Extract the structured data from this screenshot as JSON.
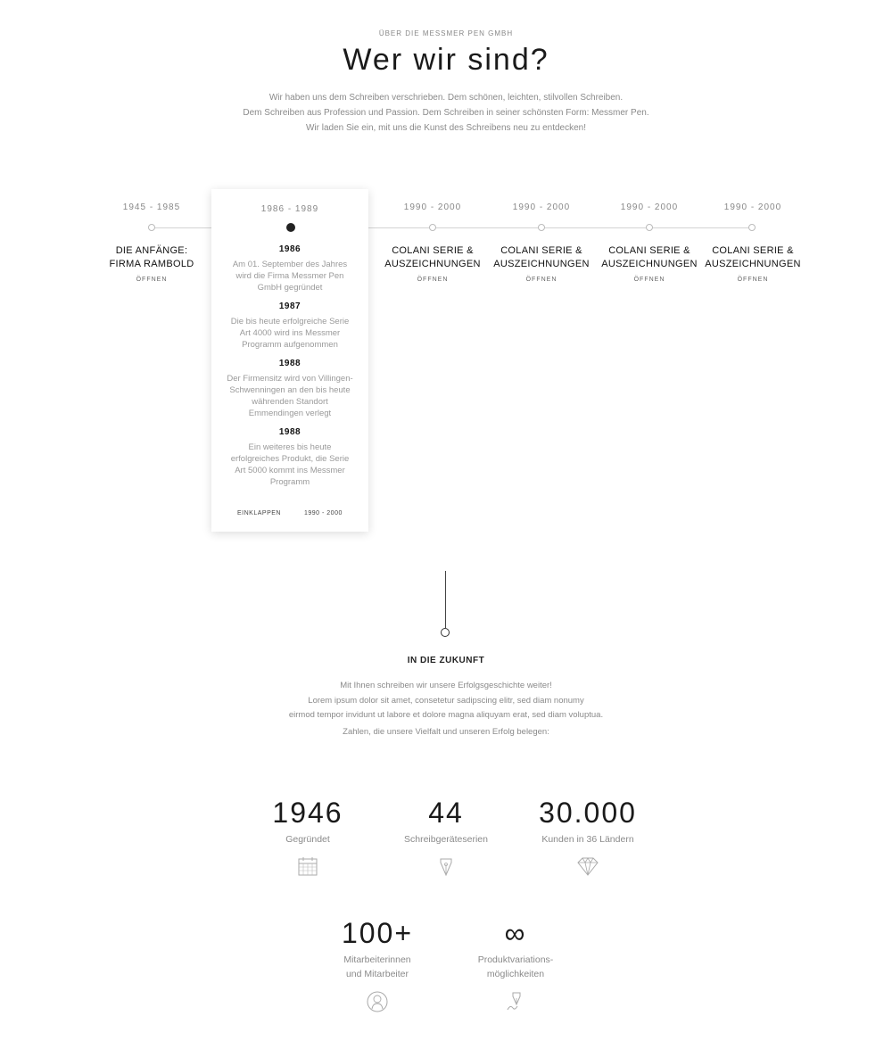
{
  "header": {
    "eyebrow": "ÜBER DIE MESSMER PEN GMBH",
    "title": "Wer wir sind?",
    "intro": [
      "Wir haben uns dem Schreiben verschrieben. Dem schönen, leichten, stilvollen Schreiben.",
      "Dem Schreiben aus Profession und Passion. Dem Schreiben in seiner schönsten Form: Messmer Pen.",
      "Wir laden Sie ein, mit uns die Kunst des Schreibens neu zu entdecken!"
    ]
  },
  "timeline": {
    "items": [
      {
        "date": "1945 - 1985",
        "title_lines": [
          "DIE ANFÄNGE:",
          "FIRMA RAMBOLD"
        ],
        "link": "ÖFFNEN"
      },
      {
        "date": "1986 - 1989",
        "expanded": true
      },
      {
        "date": "1990 - 2000",
        "title_lines": [
          "COLANI SERIE &",
          "AUSZEICHNUNGEN"
        ],
        "link": "ÖFFNEN"
      },
      {
        "date": "1990 - 2000",
        "title_lines": [
          "COLANI SERIE &",
          "AUSZEICHNUNGEN"
        ],
        "link": "ÖFFNEN"
      },
      {
        "date": "1990 - 2000",
        "title_lines": [
          "COLANI SERIE &",
          "AUSZEICHNUNGEN"
        ],
        "link": "ÖFFNEN"
      },
      {
        "date": "1990 - 2000",
        "title_lines": [
          "COLANI SERIE &",
          "AUSZEICHNUNGEN"
        ],
        "link": "ÖFFNEN"
      }
    ],
    "expanded_card": {
      "date": "1986 - 1989",
      "entries": [
        {
          "year": "1986",
          "lines": [
            "Am 01. September des Jahres",
            "wird die Firma Messmer Pen",
            "GmbH gegründet"
          ]
        },
        {
          "year": "1987",
          "lines": [
            "Die bis heute erfolgreiche Serie",
            "Art 4000 wird ins Messmer",
            "Programm aufgenommen"
          ]
        },
        {
          "year": "1988",
          "lines": [
            "Der Firmensitz wird von Villingen-",
            "Schwenningen an den bis heute",
            "währenden Standort",
            "Emmendingen verlegt"
          ]
        },
        {
          "year": "1988",
          "lines": [
            "Ein weiteres bis heute",
            "erfolgreiches Produkt, die Serie",
            "Art 5000 kommt ins Messmer",
            "Programm"
          ]
        }
      ],
      "collapse_label": "EINKLAPPEN",
      "next_label": "1990 - 2000"
    }
  },
  "future": {
    "title": "IN DIE ZUKUNFT",
    "lines": [
      "Mit Ihnen schreiben wir unsere Erfolgsgeschichte weiter!",
      "Lorem ipsum dolor sit amet, consetetur sadipscing elitr, sed diam nonumy",
      "eirmod tempor invidunt ut labore et dolore magna aliquyam erat, sed diam voluptua."
    ],
    "subline": "Zahlen, die unsere Vielfalt und unseren Erfolg belegen:"
  },
  "stats": [
    {
      "number": "1946",
      "label_lines": [
        "Gegründet"
      ],
      "icon": "calendar-icon"
    },
    {
      "number": "44",
      "label_lines": [
        "Schreibgeräteserien"
      ],
      "icon": "pen-nib-icon"
    },
    {
      "number": "30.000",
      "label_lines": [
        "Kunden in 36 Ländern"
      ],
      "icon": "diamond-icon"
    },
    {
      "number": "100+",
      "label_lines": [
        "Mitarbeiterinnen",
        "und Mitarbeiter"
      ],
      "icon": "person-icon"
    },
    {
      "number": "∞",
      "label_lines": [
        "Produktvariations-",
        "möglichkeiten"
      ],
      "icon": "pen-sketch-icon"
    }
  ]
}
